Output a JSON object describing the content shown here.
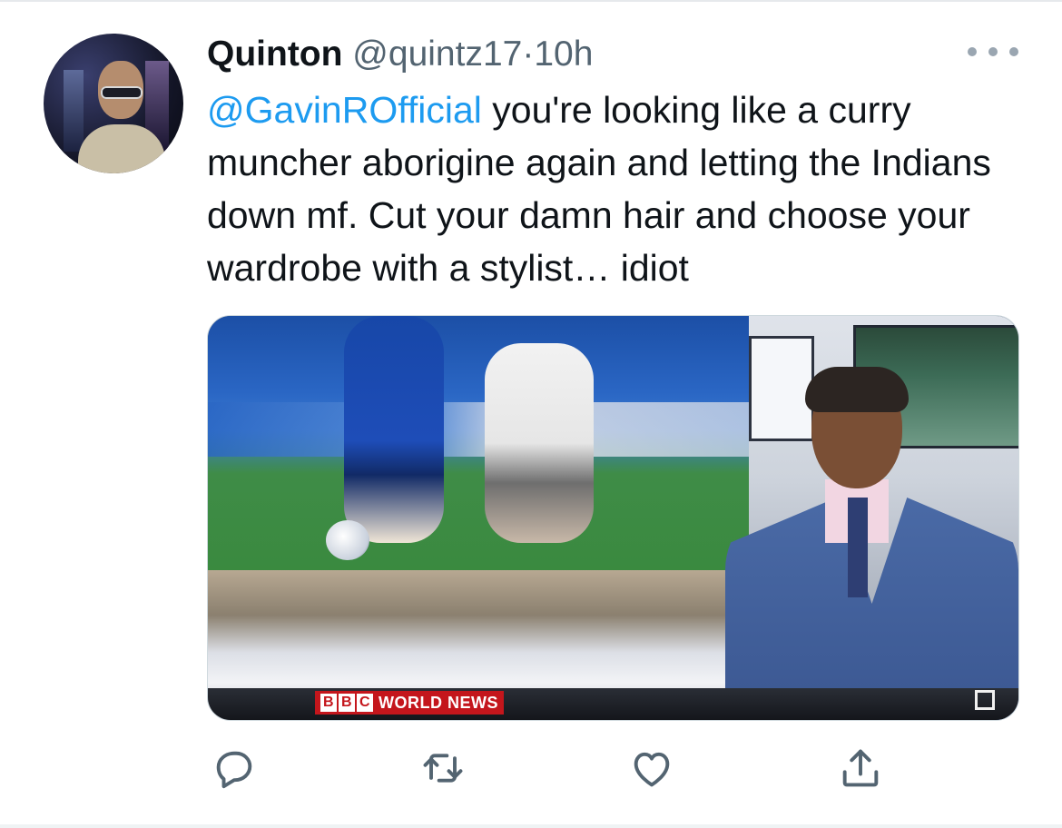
{
  "tweet": {
    "author_name": "Quinton",
    "author_handle": "@quintz17",
    "separator": "·",
    "time": "10h",
    "mention": "@GavinROfficial",
    "body": " you're looking like a curry muncher aborigine again and letting the Indians down mf. Cut your damn hair and choose your wardrobe with a stylist… idiot",
    "media": {
      "network_logo": [
        "B",
        "B",
        "C"
      ],
      "channel_label": "WORLD NEWS"
    }
  },
  "actions": {
    "reply_icon": "reply-icon",
    "retweet_icon": "retweet-icon",
    "like_icon": "heart-icon",
    "share_icon": "share-icon"
  },
  "colors": {
    "link": "#1d9bf0",
    "secondary_text": "#536471",
    "icon": "#536471",
    "bbc_red": "#c4161c"
  }
}
